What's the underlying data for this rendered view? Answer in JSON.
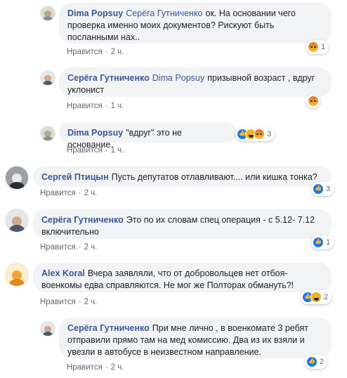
{
  "actions": {
    "like": "Нравится",
    "separator": "·"
  },
  "comments": [
    {
      "author": "Dima Popsuy",
      "mention": "Серёга Гутниченко",
      "text_lines": [
        "ок. На основании чего",
        "проверка именно моих документов? Рискуют быть",
        "посланными нах.."
      ],
      "time": "2 ч.",
      "reactions": {
        "icons": [
          "angry-icon"
        ],
        "count": "1"
      }
    },
    {
      "author": "Серёга Гутниченко",
      "mention": "Dima Popsuy",
      "text_lines": [
        "призывной возраст , вдруг",
        "уклонист"
      ],
      "time": "1 ч.",
      "reactions": {
        "icons": [
          "angry-icon"
        ],
        "count": ""
      }
    },
    {
      "author": "Dima Popsuy",
      "mention": "",
      "text_lines": [
        "\"вдруг\" это не основание."
      ],
      "time": "1 ч.",
      "reactions": {
        "icons": [
          "like-icon",
          "haha-icon",
          "angry-icon"
        ],
        "count": "3"
      }
    },
    {
      "author": "Сергей Птицын",
      "mention": "",
      "text_lines": [
        "Пусть депутатов отлавливают.... или кишка тонка?"
      ],
      "time": "2 ч.",
      "reactions": {
        "icons": [
          "like-icon"
        ],
        "count": "3"
      }
    },
    {
      "author": "Серёга Гутниченко",
      "mention": "",
      "text_lines": [
        "Это по их словам спец операция - с 5.12- 7.12",
        "включительно"
      ],
      "time": "2 ч.",
      "reactions": {
        "icons": [
          "like-icon"
        ],
        "count": "1"
      }
    },
    {
      "author": "Alex Koral",
      "mention": "",
      "text_lines": [
        "Вчера заявляли, что от добровольцев нет отбоя-",
        "военкомы едва справляются. Не мог же Полторак обмануть?!"
      ],
      "time": "2 ч.",
      "reactions": {
        "icons": [
          "like-icon",
          "haha-icon"
        ],
        "count": "2"
      }
    },
    {
      "author": "Серёга Гутниченко",
      "mention": "",
      "text_lines": [
        "При мне лично , в военкомате 3 ребят",
        "отправили прямо там на мед комиссию. Два из их взяли и",
        "увезли в автобусе в неизвестном направление."
      ],
      "time": "2 ч.",
      "reactions": {
        "icons": [
          "like-icon"
        ],
        "count": "2"
      }
    }
  ],
  "colors": {
    "author": "#385898",
    "bubble": "#f2f3f5",
    "meta": "#606770"
  }
}
